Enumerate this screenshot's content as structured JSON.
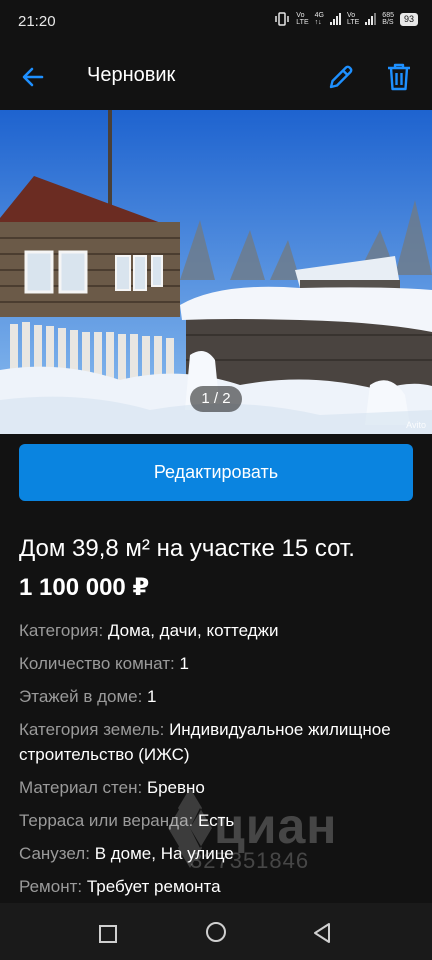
{
  "status_bar": {
    "time": "21:20",
    "net_speed_top": "685",
    "net_speed_bottom": "B/S",
    "sim1_top": "Vo",
    "sim1_bottom": "LTE",
    "sim2_top": "Vo",
    "sim2_bottom": "LTE",
    "network": "4G",
    "battery": "93"
  },
  "app_bar": {
    "title": "Черновик",
    "back_icon": "arrow-left-icon",
    "edit_icon": "pencil-icon",
    "delete_icon": "trash-icon"
  },
  "gallery": {
    "counter": "1 / 2",
    "watermark": "Avito"
  },
  "actions": {
    "edit_label": "Редактировать"
  },
  "listing": {
    "title": "Дом 39,8 м² на участке 15 сот.",
    "price": "1 100 000 ₽",
    "params": [
      {
        "key": "Категория:",
        "value": "Дома, дачи, коттеджи"
      },
      {
        "key": "Количество комнат:",
        "value": "1"
      },
      {
        "key": "Этажей в доме:",
        "value": "1"
      },
      {
        "key": "Категория земель:",
        "value": "Индивидуальное жилищное строительство (ИЖС)"
      },
      {
        "key": "Материал стен:",
        "value": "Бревно"
      },
      {
        "key": "Терраса или веранда:",
        "value": "Есть"
      },
      {
        "key": "Санузел:",
        "value": "В доме, На улице"
      },
      {
        "key": "Ремонт:",
        "value": "Требует ремонта"
      }
    ]
  },
  "overlay_watermark": {
    "brand": "циан",
    "phone": "327351846"
  },
  "colors": {
    "accent": "#0a84e0",
    "background": "#121212",
    "label": "#9a9a9a"
  }
}
